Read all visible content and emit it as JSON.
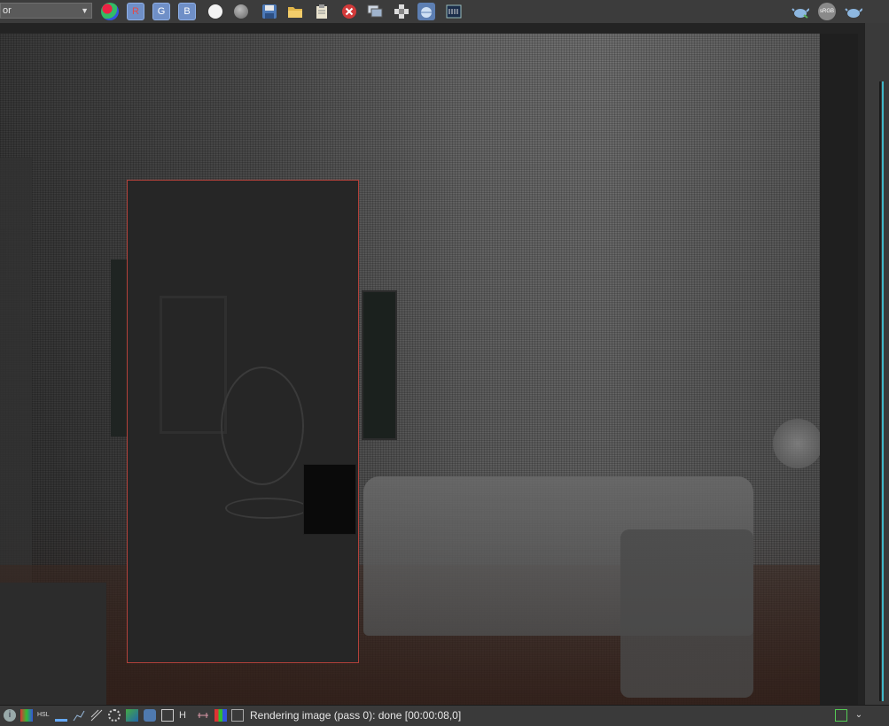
{
  "toolbar": {
    "display_select_value": "or",
    "channel_r": "R",
    "channel_g": "G",
    "channel_b": "B",
    "icons": [
      "color-channels-icon",
      "red-channel-icon",
      "green-channel-icon",
      "blue-channel-icon",
      "white-sphere-icon",
      "gray-sphere-icon",
      "save-icon",
      "open-folder-icon",
      "clipboard-icon",
      "stop-render-icon",
      "compare-icon",
      "region-icon",
      "render-icon",
      "vfb-history-icon",
      "teapot-render-icon",
      "srgb-icon",
      "teapot-icon"
    ],
    "srgb_label": "sRGB"
  },
  "status": {
    "text": "Rendering image (pass 0): done [00:00:08,0]",
    "icons": [
      "info-icon",
      "color-correction-icon",
      "hsl-icon",
      "levels-icon",
      "curves-icon",
      "exposure-icon",
      "lut-icon",
      "background-icon",
      "ocio-icon",
      "white-balance-icon",
      "hue-icon",
      "lens-effects-icon",
      "stamp-icon",
      "expand-icon",
      "dropdown-icon"
    ],
    "hsl_label": "HSL",
    "h_label": "H"
  },
  "colors": {
    "region_border": "#b2413a",
    "toolbar_bg": "#3c3c3c",
    "status_text": "#e6e6e6"
  }
}
